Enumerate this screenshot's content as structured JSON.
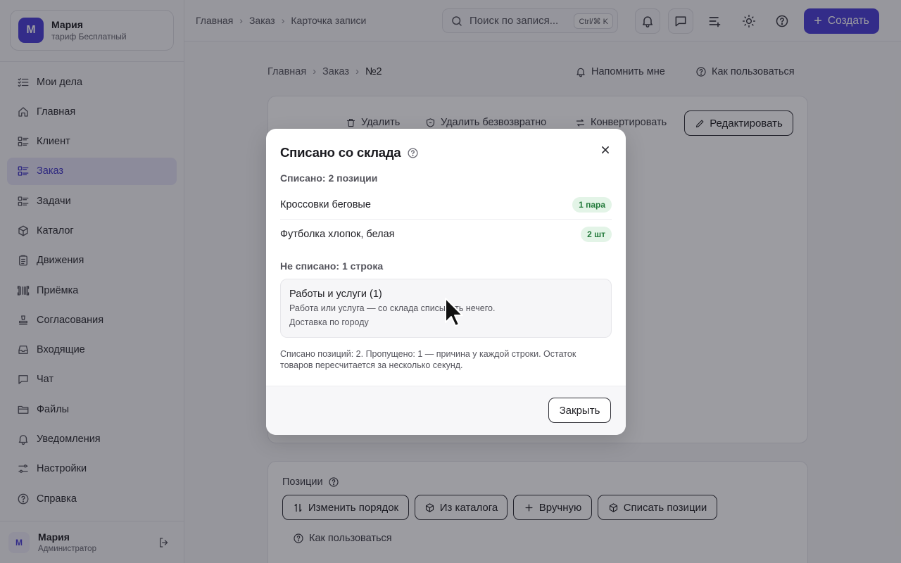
{
  "sidebar": {
    "profile": {
      "initial": "М",
      "name": "Мария",
      "plan": "тариф Бесплатный"
    },
    "items": [
      {
        "label": "Мои дела",
        "icon": "checklist-icon"
      },
      {
        "label": "Главная",
        "icon": "home-icon"
      },
      {
        "label": "Клиент",
        "icon": "list-icon"
      },
      {
        "label": "Заказ",
        "icon": "list-icon",
        "active": true
      },
      {
        "label": "Задачи",
        "icon": "list-icon"
      },
      {
        "label": "Каталог",
        "icon": "box-icon"
      },
      {
        "label": "Движения",
        "icon": "clipboard-icon"
      },
      {
        "label": "Приёмка",
        "icon": "barcode-icon"
      },
      {
        "label": "Согласования",
        "icon": "stamp-icon"
      },
      {
        "label": "Входящие",
        "icon": "inbox-icon"
      },
      {
        "label": "Чат",
        "icon": "chat-icon"
      },
      {
        "label": "Файлы",
        "icon": "folder-icon"
      },
      {
        "label": "Уведомления",
        "icon": "bell-icon"
      },
      {
        "label": "Настройки",
        "icon": "sliders-icon"
      },
      {
        "label": "Справка",
        "icon": "help-icon"
      }
    ],
    "user": {
      "initial": "М",
      "name": "Мария",
      "role": "Администратор"
    }
  },
  "topbar": {
    "breadcrumb": [
      "Главная",
      "Заказ",
      "Карточка записи"
    ],
    "search_placeholder": "Поиск по запися...",
    "shortcut": "Ctrl/⌘ K",
    "create_label": "Создать"
  },
  "main": {
    "breadcrumb": [
      "Главная",
      "Заказ",
      "№2"
    ],
    "remind_label": "Напомнить мне",
    "howto_label": "Как пользоваться",
    "actions": {
      "delete": "Удалить",
      "delete_forever": "Удалить безвозвратно",
      "convert": "Конвертировать",
      "edit": "Редактировать"
    },
    "positions": {
      "title": "Позиции",
      "reorder": "Изменить порядок",
      "from_catalog": "Из каталога",
      "manual": "Вручную",
      "write_off": "Списать позиции",
      "howto": "Как пользоваться"
    }
  },
  "modal": {
    "title": "Списано со склада",
    "written_header": "Списано: 2 позиции",
    "written_items": [
      {
        "name": "Кроссовки беговые",
        "qty": "1 пара"
      },
      {
        "name": "Футболка хлопок, белая",
        "qty": "2 шт"
      }
    ],
    "not_written_header": "Не списано: 1 строка",
    "skipped": {
      "title": "Работы и услуги (1)",
      "reason": "Работа или услуга — со склада списывать нечего.",
      "items": [
        "Доставка по городу"
      ]
    },
    "note": "Списано позиций: 2. Пропущено: 1 — причина у каждой строки. Остаток товаров пересчитается за несколько секунд.",
    "close_label": "Закрыть"
  },
  "colors": {
    "accent": "#4b3fd6",
    "active_nav_bg": "#e4e2f5",
    "badge_bg": "#e3f4e7",
    "badge_text": "#237a3b"
  }
}
